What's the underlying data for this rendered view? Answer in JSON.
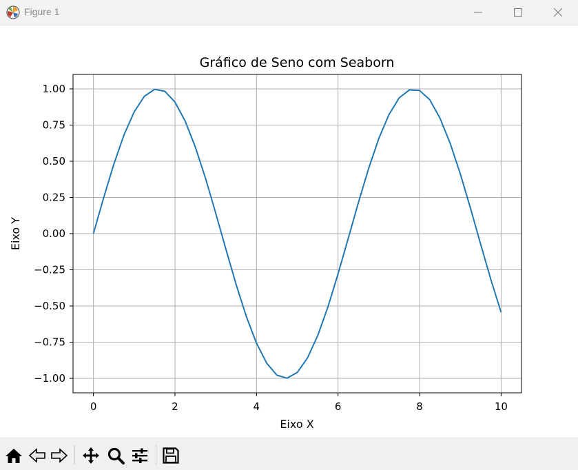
{
  "window": {
    "title": "Figure 1",
    "app_icon": "matplotlib-icon",
    "controls": [
      "minimize-icon",
      "maximize-icon",
      "close-icon"
    ]
  },
  "chart_data": {
    "type": "line",
    "title": "Gráfico de Seno com Seaborn",
    "xlabel": "Eixo X",
    "ylabel": "Eixo Y",
    "xlim": [
      -0.5,
      10.5
    ],
    "ylim": [
      -1.1,
      1.1
    ],
    "xticks": [
      0,
      2,
      4,
      6,
      8,
      10
    ],
    "xtick_labels": [
      "0",
      "2",
      "4",
      "6",
      "8",
      "10"
    ],
    "yticks": [
      1.0,
      0.75,
      0.5,
      0.25,
      0.0,
      -0.25,
      -0.5,
      -0.75,
      -1.0
    ],
    "ytick_labels": [
      "1.00",
      "0.75",
      "0.50",
      "0.25",
      "0.00",
      "−0.25",
      "−0.50",
      "−0.75",
      "−1.00"
    ],
    "grid": true,
    "line_color": "#1f77b4",
    "series": [
      {
        "x": [
          0,
          0.25,
          0.5,
          0.75,
          1,
          1.25,
          1.5,
          1.75,
          2,
          2.25,
          2.5,
          2.75,
          3,
          3.25,
          3.5,
          3.75,
          4,
          4.25,
          4.5,
          4.75,
          5,
          5.25,
          5.5,
          5.75,
          6,
          6.25,
          6.5,
          6.75,
          7,
          7.25,
          7.5,
          7.75,
          8,
          8.25,
          8.5,
          8.75,
          9,
          9.25,
          9.5,
          9.75,
          10
        ],
        "y": [
          0,
          0.247,
          0.479,
          0.682,
          0.841,
          0.949,
          0.997,
          0.984,
          0.909,
          0.778,
          0.598,
          0.382,
          0.141,
          -0.108,
          -0.351,
          -0.572,
          -0.757,
          -0.895,
          -0.978,
          -0.999,
          -0.959,
          -0.859,
          -0.706,
          -0.508,
          -0.279,
          -0.033,
          0.215,
          0.45,
          0.657,
          0.823,
          0.938,
          0.993,
          0.989,
          0.925,
          0.798,
          0.624,
          0.412,
          0.174,
          -0.075,
          -0.319,
          -0.544
        ]
      }
    ]
  },
  "toolbar": {
    "buttons": [
      "home-icon",
      "back-icon",
      "forward-icon",
      "pan-icon",
      "zoom-icon",
      "configure-subplots-icon",
      "save-icon"
    ]
  }
}
